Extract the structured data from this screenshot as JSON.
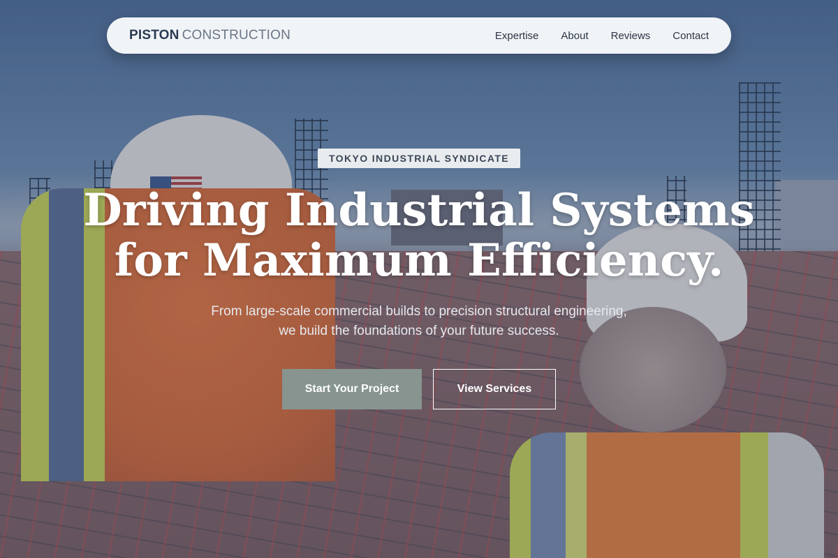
{
  "nav": {
    "brand_bold": "PISTON",
    "brand_light": "CONSTRUCTION",
    "links": [
      "Expertise",
      "About",
      "Reviews",
      "Contact"
    ]
  },
  "hero": {
    "badge": "TOKYO INDUSTRIAL SYNDICATE",
    "headline_line1": "Driving Industrial Systems",
    "headline_line2": "for Maximum Efficiency.",
    "subtext": "From large-scale commercial builds to precision structural engineering, we build the foundations of your future success.",
    "primary_cta": "Start Your Project",
    "secondary_cta": "View Services"
  },
  "colors": {
    "nav_background": "#f1f4f7",
    "primary_button": "#87948f",
    "headline_text": "#ffffff"
  }
}
